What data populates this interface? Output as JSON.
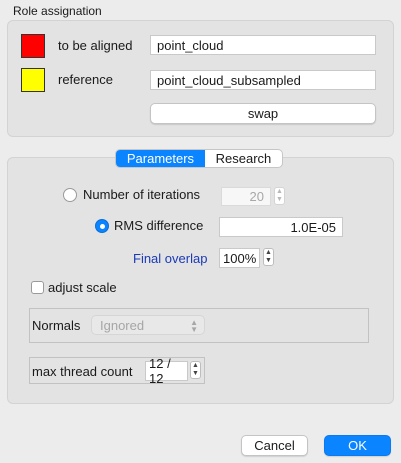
{
  "role_assignation": {
    "title": "Role assignation",
    "to_be_aligned": {
      "label": "to be aligned",
      "value": "point_cloud",
      "color": "#ff0000"
    },
    "reference": {
      "label": "reference",
      "value": "point_cloud_subsampled",
      "color": "#ffff00"
    },
    "swap_label": "swap"
  },
  "tabs": [
    {
      "label": "Parameters",
      "active": true
    },
    {
      "label": "Research",
      "active": false
    }
  ],
  "parameters": {
    "iterations_label": "Number of iterations",
    "iterations_value": "20",
    "rms_label": "RMS difference",
    "rms_value": "1.0E-05",
    "overlap_label": "Final overlap",
    "overlap_value": "100%",
    "adjust_scale_label": "adjust scale",
    "normals_label": "Normals",
    "normals_value": "Ignored",
    "thread_label": "max thread count",
    "thread_value": "12 / 12"
  },
  "footer": {
    "cancel_label": "Cancel",
    "ok_label": "OK"
  },
  "colors": {
    "accent": "#0a84ff",
    "link_text": "#1a3ab8"
  }
}
